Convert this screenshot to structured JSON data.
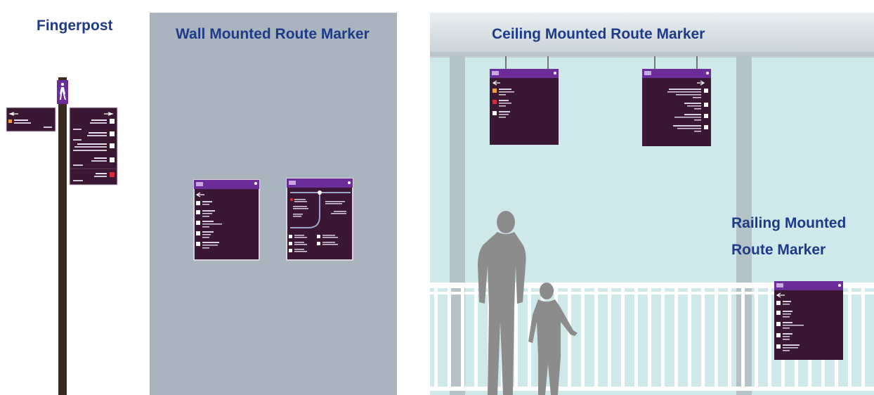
{
  "colors": {
    "heading_text": "#1f3a87",
    "sign_purple": "#6a2d9a",
    "sign_body": "#3a1733",
    "wall_grey": "#a9b4bf",
    "glass_blue": "#cfe8ea",
    "silhouette": "#8c8c8c"
  },
  "headings": {
    "fingerpost": "Fingerpost",
    "wall": "Wall Mounted Route Marker",
    "ceiling": "Ceiling Mounted Route Marker",
    "railing": "Railing Mounted Route Marker"
  },
  "icons": [
    "pedestrian-icon",
    "arrow-left-icon",
    "arrow-right-icon"
  ]
}
